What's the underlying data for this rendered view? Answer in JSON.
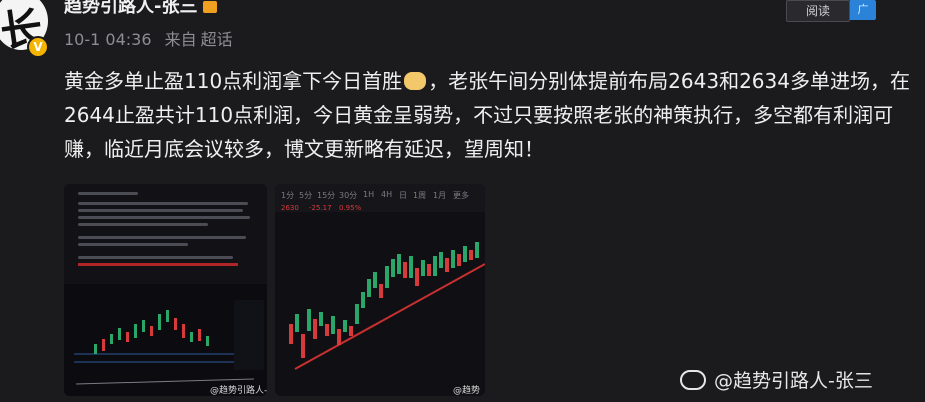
{
  "user": {
    "name": "趋势引路人-张三",
    "avatar_glyph": "长",
    "verified_badge": "V",
    "timestamp": "10-1 04:36",
    "source_prefix": "来自",
    "source": "超话"
  },
  "toolbar": {
    "read_label": "阅读",
    "side_tab_label": "广"
  },
  "post": {
    "text_before_emoji": "黄金多单止盈110点利润拿下今日首胜",
    "text_after_emoji": "，老张午间分别体提前布局2643和2634多单进场，在2644止盈共计110点利润，今日黄金呈弱势，不过只要按照老张的神策执行，多空都有利润可赚，临近月底会议较多，博文更新略有延迟，望周知！"
  },
  "images": [
    {
      "type": "screenshot-document-chart",
      "watermark": "@趋势引路人-张"
    },
    {
      "type": "screenshot-candlestick-chart",
      "tabs": [
        "1分",
        "5分",
        "15分",
        "30分",
        "1H",
        "4H",
        "日",
        "1周",
        "1月",
        "更多"
      ],
      "quote": {
        "price": "2630",
        "change": "-25.17",
        "percent": "0.95%"
      },
      "watermark": "@趋势"
    }
  ],
  "footer_watermark": "@趋势引路人-张三",
  "colors": {
    "bg": "#1b1b1e",
    "text": "#efefef",
    "muted": "#8d8d92",
    "accent_blue": "#2b82d9",
    "up": "#2aa66a",
    "down": "#d63a3a",
    "trend": "#c83030"
  }
}
